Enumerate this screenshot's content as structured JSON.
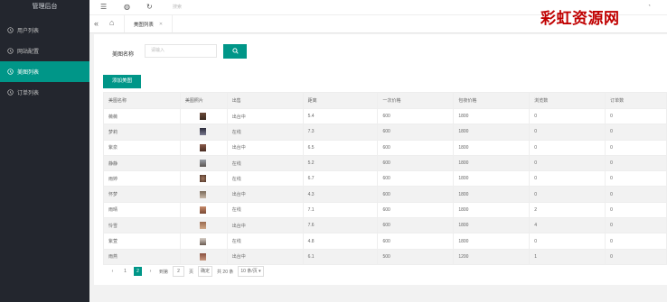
{
  "sidebar": {
    "brand": "管理后台",
    "items": [
      {
        "label": "用户列表",
        "icon": "clock-icon"
      },
      {
        "label": "网站配置",
        "icon": "clock-icon"
      },
      {
        "label": "美图列表",
        "icon": "clock-icon"
      },
      {
        "label": "订单列表",
        "icon": "clock-icon"
      }
    ]
  },
  "topbar": {
    "search_text": "搜索"
  },
  "tabs": {
    "active_tab": "美图列表"
  },
  "watermark": "彩虹资源网",
  "search": {
    "label": "美图名称",
    "placeholder": "请输入"
  },
  "add_button": "添加美图",
  "table": {
    "headers": [
      "美图名称",
      "美图照片",
      "出售",
      "距离",
      "一次价格",
      "包夜价格",
      "浏览数",
      "订单数"
    ],
    "rows": [
      {
        "name": "薇薇",
        "status": "出台中",
        "distance": "5.4",
        "once": "600",
        "night": "1800",
        "views": "0",
        "orders": "0"
      },
      {
        "name": "梦莉",
        "status": "在线",
        "distance": "7.3",
        "once": "600",
        "night": "1800",
        "views": "0",
        "orders": "0"
      },
      {
        "name": "紫泉",
        "status": "出台中",
        "distance": "6.5",
        "once": "600",
        "night": "1800",
        "views": "0",
        "orders": "0"
      },
      {
        "name": "静静",
        "status": "在线",
        "distance": "5.2",
        "once": "600",
        "night": "1800",
        "views": "0",
        "orders": "0"
      },
      {
        "name": "雨婷",
        "status": "在线",
        "distance": "6.7",
        "once": "600",
        "night": "1800",
        "views": "0",
        "orders": "0"
      },
      {
        "name": "怀梦",
        "status": "出台中",
        "distance": "4.3",
        "once": "600",
        "night": "1800",
        "views": "0",
        "orders": "0"
      },
      {
        "name": "雨晴",
        "status": "在线",
        "distance": "7.1",
        "once": "600",
        "night": "1800",
        "views": "2",
        "orders": "0"
      },
      {
        "name": "怜雪",
        "status": "出台中",
        "distance": "7.6",
        "once": "600",
        "night": "1800",
        "views": "4",
        "orders": "0"
      },
      {
        "name": "紫萱",
        "status": "在线",
        "distance": "4.8",
        "once": "600",
        "night": "1800",
        "views": "0",
        "orders": "0"
      },
      {
        "name": "雨燕",
        "status": "出台中",
        "distance": "6.1",
        "once": "500",
        "night": "1200",
        "views": "1",
        "orders": "0"
      }
    ]
  },
  "pager": {
    "page1": "1",
    "page2": "2",
    "goto_label": "到第",
    "goto_value": "2",
    "page_unit": "页",
    "confirm": "确定",
    "total": "共 20 条",
    "per_page": "10 条/页"
  },
  "colors": {
    "accent": "#009688",
    "sidebar_bg": "#23262e",
    "watermark": "#c00000"
  }
}
